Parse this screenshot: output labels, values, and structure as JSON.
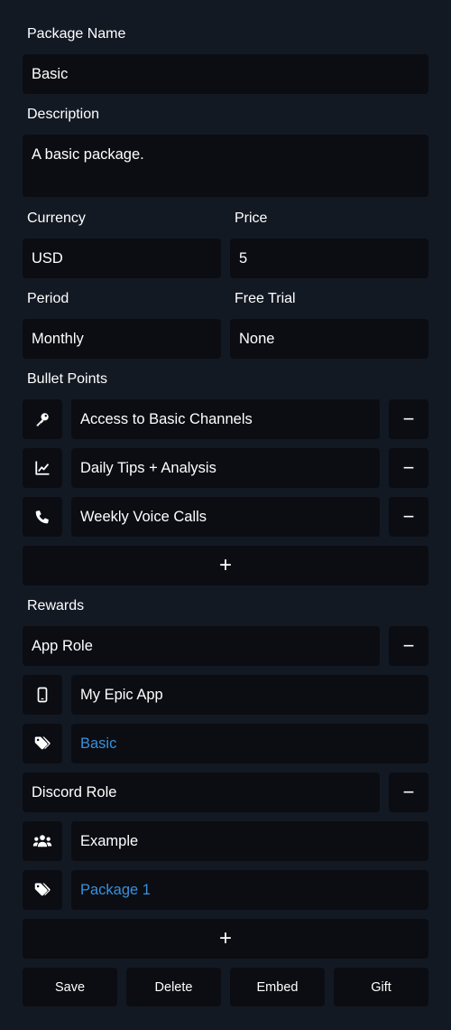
{
  "form": {
    "package_name": {
      "label": "Package Name",
      "value": "Basic"
    },
    "description": {
      "label": "Description",
      "value": "A basic package."
    },
    "currency": {
      "label": "Currency",
      "value": "USD"
    },
    "price": {
      "label": "Price",
      "value": "5"
    },
    "period": {
      "label": "Period",
      "value": "Monthly"
    },
    "free_trial": {
      "label": "Free Trial",
      "value": "None"
    }
  },
  "bullets": {
    "label": "Bullet Points",
    "items": [
      {
        "icon": "key-icon",
        "text": "Access to Basic Channels"
      },
      {
        "icon": "chart-line-icon",
        "text": "Daily Tips + Analysis"
      },
      {
        "icon": "phone-icon",
        "text": "Weekly Voice Calls"
      }
    ],
    "add_symbol": "+",
    "remove_symbol": "−"
  },
  "rewards": {
    "label": "Rewards",
    "items": [
      {
        "type": "App Role",
        "rows": [
          {
            "icon": "mobile-icon",
            "value": "My Epic App",
            "highlight": false
          },
          {
            "icon": "tags-icon",
            "value": "Basic",
            "highlight": true
          }
        ]
      },
      {
        "type": "Discord Role",
        "rows": [
          {
            "icon": "users-icon",
            "value": "Example",
            "highlight": false
          },
          {
            "icon": "tags-icon",
            "value": "Package 1",
            "highlight": true
          }
        ]
      }
    ],
    "add_symbol": "+",
    "remove_symbol": "−"
  },
  "actions": {
    "save": "Save",
    "delete": "Delete",
    "embed": "Embed",
    "gift": "Gift"
  },
  "colors": {
    "background": "#131923",
    "field": "#0b0d12",
    "accent_link": "#3b8fdc",
    "text": "#ffffff"
  }
}
